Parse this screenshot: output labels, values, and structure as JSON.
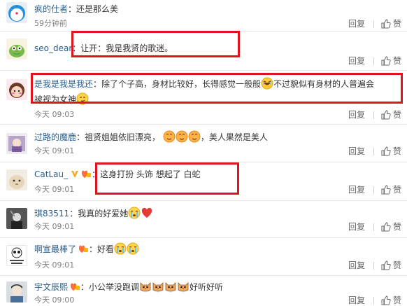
{
  "actions": {
    "reply": "回复",
    "like": "赞"
  },
  "comments": [
    {
      "user": "疯的仕者",
      "text": "还是那么美",
      "time": "59分钟前"
    },
    {
      "user": "seo_dear",
      "text": "让开：我是我贤的歌迷。",
      "time": ""
    },
    {
      "user": "是我是我是我还",
      "text_1": "除了个子高，身材比较好，长得感觉一般般",
      "text_2": "不过貌似有身材的人普遍会",
      "text_3": "被视为女神",
      "time": "今天 09:03"
    },
    {
      "user": "过路的魔鹿",
      "text": "祖贤姐姐依旧漂亮，",
      "text_after": "，美人果然是美人",
      "time": "今天 09:01"
    },
    {
      "user": "CatLau_",
      "text": "这身打扮 头饰 想起了 白蛇",
      "time": "今天 09:01"
    },
    {
      "user": "琪83511",
      "text": "我真的好爱她",
      "time": "今天 09:01"
    },
    {
      "user": "啊宣最棒了",
      "text": "好看",
      "time": "今天 09:01"
    },
    {
      "user": "宇文辰熙",
      "text": "小公举没跑调",
      "text_after": "好听好听",
      "time": "今天 09:00"
    }
  ],
  "colors": {
    "username": "#2a5e8c",
    "highlight": "#e0141e",
    "time": "#808080"
  }
}
